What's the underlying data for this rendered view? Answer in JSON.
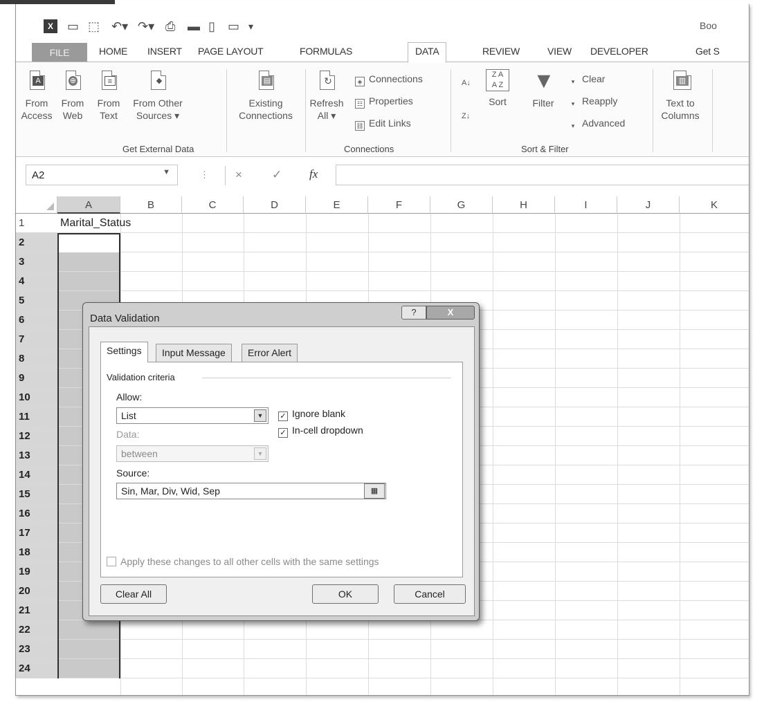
{
  "app": {
    "book_label": "Boo"
  },
  "qat": {
    "icons": [
      "excel-icon",
      "save-icon",
      "touch-icon",
      "undo-icon",
      "redo-icon",
      "print-icon",
      "folder-icon",
      "new-icon",
      "comment-icon",
      "customize-icon"
    ]
  },
  "tabs": {
    "file": "FILE",
    "home": "HOME",
    "insert": "INSERT",
    "page_layout": "PAGE LAYOUT",
    "formulas": "FORMULAS",
    "data": "DATA",
    "review": "REVIEW",
    "view": "VIEW",
    "developer": "DEVELOPER",
    "get": "Get S"
  },
  "ribbon": {
    "from_access": [
      "From",
      "Access"
    ],
    "from_web": [
      "From",
      "Web"
    ],
    "from_text": [
      "From",
      "Text"
    ],
    "from_other": [
      "From Other",
      "Sources ▾"
    ],
    "existing": [
      "Existing",
      "Connections"
    ],
    "refresh": [
      "Refresh",
      "All ▾"
    ],
    "connections": "Connections",
    "properties": "Properties",
    "edit_links": "Edit Links",
    "sort": "Sort",
    "filter": "Filter",
    "clear": "Clear",
    "reapply": "Reapply",
    "advanced": "Advanced",
    "text_to": [
      "Text to",
      "Columns"
    ],
    "group_external": "Get External Data",
    "group_connections": "Connections",
    "group_sort": "Sort & Filter"
  },
  "formula_bar": {
    "name_box": "A2",
    "fx": "fx",
    "cancel": "×",
    "enter": "✓",
    "formula": ""
  },
  "sheet": {
    "columns": [
      "A",
      "B",
      "C",
      "D",
      "E",
      "F",
      "G",
      "H",
      "I",
      "J",
      "K"
    ],
    "rows": [
      "1",
      "2",
      "3",
      "4",
      "5",
      "6",
      "7",
      "8",
      "9",
      "10",
      "11",
      "12",
      "13",
      "14",
      "15",
      "16",
      "17",
      "18",
      "19",
      "20",
      "21",
      "22",
      "23",
      "24"
    ],
    "a1": "Marital_Status"
  },
  "dialog": {
    "title": "Data Validation",
    "help": "?",
    "close": "X",
    "tabs": [
      "Settings",
      "Input Message",
      "Error Alert"
    ],
    "section": "Validation criteria",
    "allow_label": "Allow:",
    "allow_value": "List",
    "data_label": "Data:",
    "data_value": "between",
    "ignore_blank": "Ignore blank",
    "in_cell": "In-cell dropdown",
    "source_label": "Source:",
    "source_value": "Sin, Mar, Div, Wid, Sep",
    "apply_all": "Apply these changes to all other cells with the same settings",
    "clear_all": "Clear All",
    "ok": "OK",
    "cancel": "Cancel"
  }
}
